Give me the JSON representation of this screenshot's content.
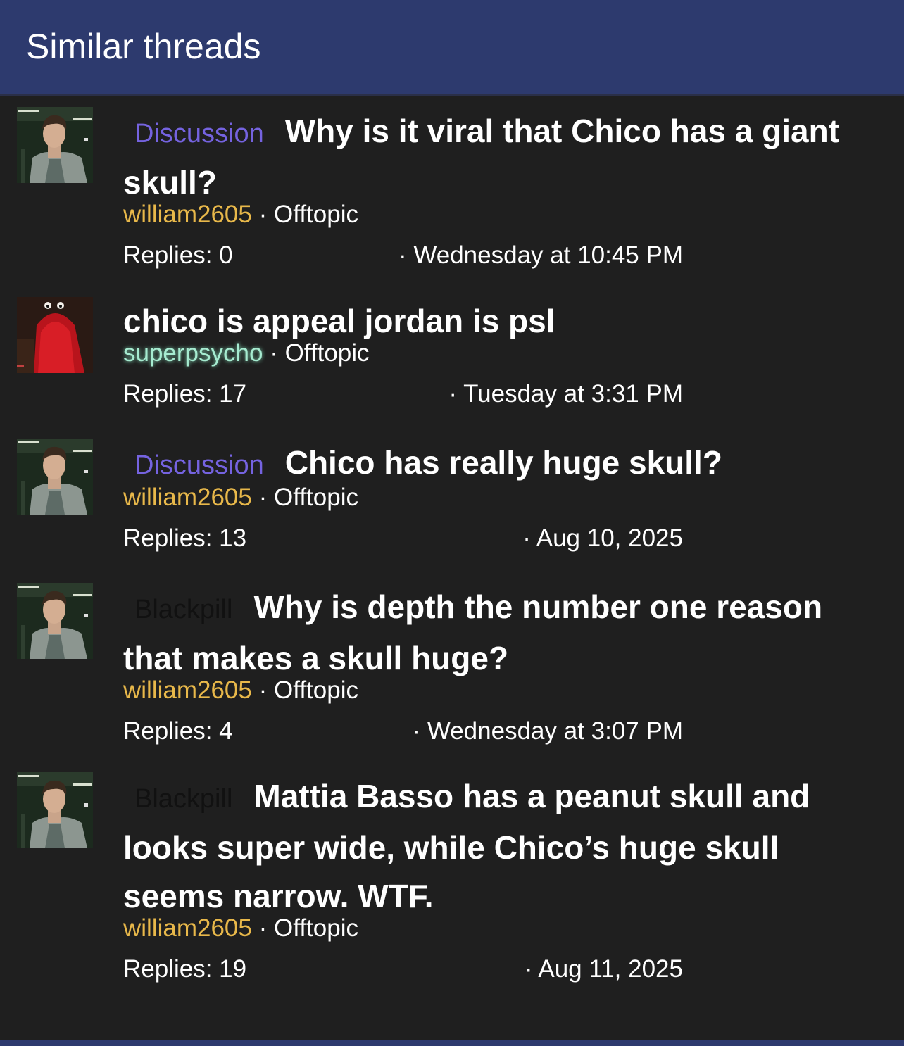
{
  "header": {
    "title": "Similar threads"
  },
  "threads": [
    {
      "prefix": "Discussion",
      "title": "Why is it viral that Chico has a giant skull?",
      "author": "william2605",
      "forum": "Offtopic",
      "replies": "Replies: 0",
      "date": "Wednesday at 10:45 PM"
    },
    {
      "prefix": "",
      "title": "chico is appeal jordan is psl",
      "author": "superpsycho",
      "forum": "Offtopic",
      "replies": "Replies: 17",
      "date": "Tuesday at 3:31 PM"
    },
    {
      "prefix": "Discussion",
      "title": "Chico has really huge skull?",
      "author": "william2605",
      "forum": "Offtopic",
      "replies": "Replies: 13",
      "date": "Aug 10, 2025"
    },
    {
      "prefix": "Blackpill",
      "title": "Why is depth the number one reason that makes a skull huge?",
      "author": "william2605",
      "forum": "Offtopic",
      "replies": "Replies: 4",
      "date": "Wednesday at 3:07 PM"
    },
    {
      "prefix": "Blackpill",
      "title": "Mattia Basso has a peanut skull and looks super wide, while Chico’s huge skull seems narrow. WTF.",
      "author": "william2605",
      "forum": "Offtopic",
      "replies": "Replies: 19",
      "date": "Aug 11, 2025"
    }
  ],
  "separator": "·",
  "colors": {
    "header_bg": "#2d3a6e",
    "page_bg": "#1f1f1f",
    "discussion_prefix": "#7563e0",
    "blackpill_prefix": "#111111",
    "author_gold": "#e8b84a",
    "author_green": "#a6ebd0"
  },
  "icons": {
    "avatar_william2605": "avatar-photo-man",
    "avatar_superpsycho": "avatar-red-muppet"
  }
}
